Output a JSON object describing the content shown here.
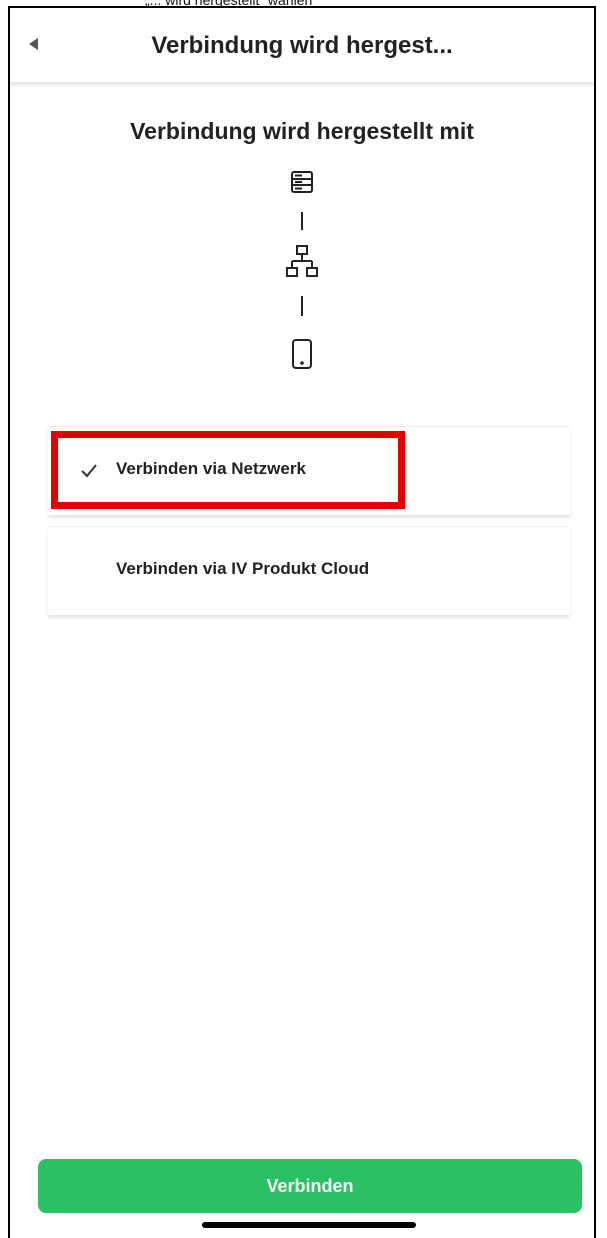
{
  "top_caption": "„... wird hergestellt“ wählen",
  "navbar": {
    "back_icon": "back-triangle-icon",
    "title": "Verbindung wird hergest..."
  },
  "heading": "Verbindung wird hergestellt mit",
  "diagram": {
    "icons": [
      "server-icon",
      "network-icon",
      "smartphone-icon"
    ]
  },
  "options": [
    {
      "label": "Verbinden via Netzwerk",
      "selected": true,
      "icon": "checkmark-icon"
    },
    {
      "label": "Verbinden via IV Produkt Cloud",
      "selected": false
    }
  ],
  "connect_button": {
    "label": "Verbinden"
  },
  "colors": {
    "accent_green": "#2bc063",
    "highlight_red": "#e60000"
  }
}
